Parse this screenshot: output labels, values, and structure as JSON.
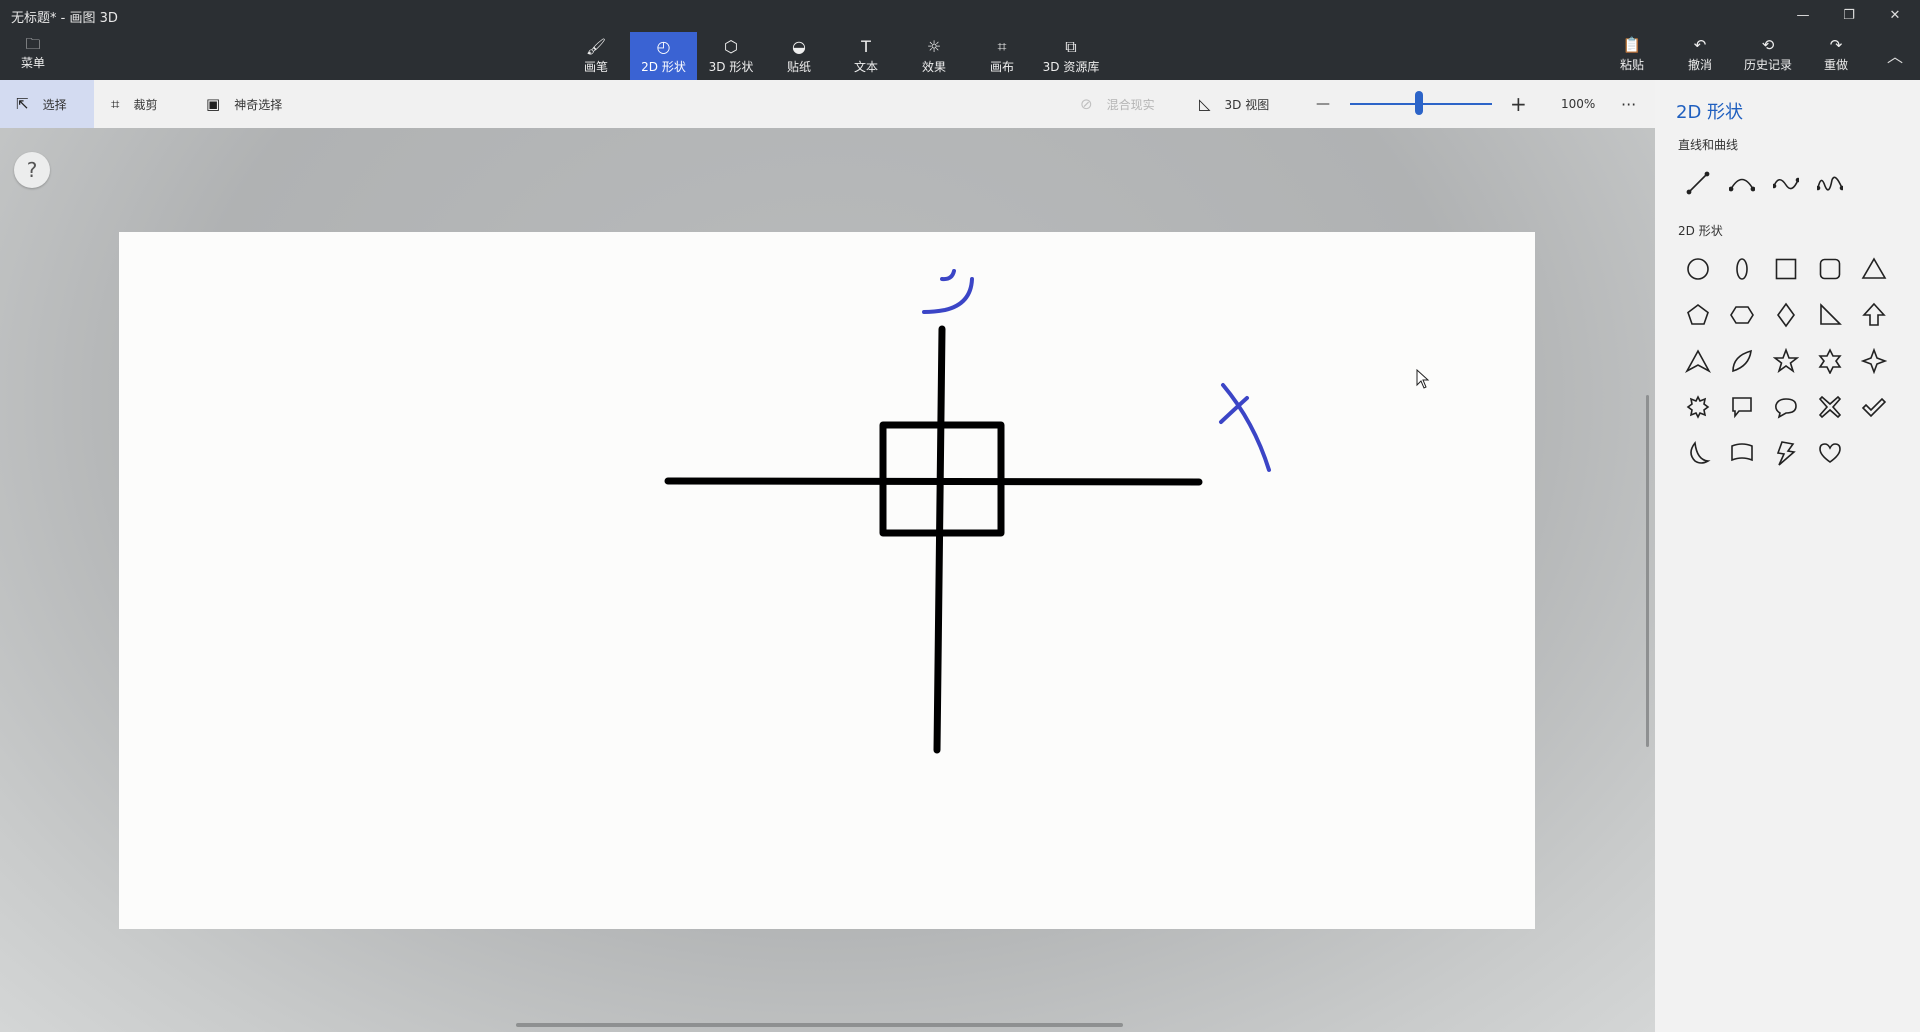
{
  "window": {
    "title": "无标题* - 画图 3D",
    "minimize": "—",
    "restore": "❐",
    "close": "✕"
  },
  "menu": {
    "label": "菜单",
    "icon": "folder-icon"
  },
  "tabs": [
    {
      "label": "画笔",
      "icon": "brush-icon"
    },
    {
      "label": "2D 形状",
      "icon": "2d-shapes-icon",
      "active": true
    },
    {
      "label": "3D 形状",
      "icon": "3d-shapes-icon"
    },
    {
      "label": "贴纸",
      "icon": "sticker-icon"
    },
    {
      "label": "文本",
      "icon": "text-icon"
    },
    {
      "label": "效果",
      "icon": "effects-icon"
    },
    {
      "label": "画布",
      "icon": "canvas-icon"
    },
    {
      "label": "3D 资源库",
      "icon": "3d-library-icon"
    }
  ],
  "right_actions": {
    "paste": "粘贴",
    "undo": "撤消",
    "history": "历史记录",
    "redo": "重做"
  },
  "toolbar": {
    "select": "选择",
    "crop": "裁剪",
    "magic_select": "神奇选择",
    "mixed_reality": "混合现实",
    "view_3d": "3D 视图",
    "zoom_out": "—",
    "zoom_in": "+",
    "zoom_percent": "100%",
    "more": "···",
    "zoom_level": 0.55
  },
  "help": {
    "label": "?"
  },
  "panel": {
    "title": "2D 形状",
    "lines_heading": "直线和曲线",
    "shapes_heading": "2D 形状",
    "lines": [
      "line-icon",
      "curve-icon",
      "three-point-curve-icon",
      "four-point-curve-icon"
    ],
    "shapes": [
      "circle-icon",
      "ellipse-icon",
      "square-icon",
      "rounded-square-icon",
      "triangle-icon",
      "pentagon-icon",
      "hexagon-icon",
      "diamond-icon",
      "right-triangle-icon",
      "arrow-up-icon",
      "arrow-head-icon",
      "leaf-icon",
      "star-five-icon",
      "star-six-icon",
      "star-four-icon",
      "burst-icon",
      "square-callout-icon",
      "round-callout-icon",
      "x-mark-icon",
      "check-mark-icon",
      "moon-icon",
      "banner-icon",
      "lightning-icon",
      "heart-icon"
    ]
  },
  "colors": {
    "accent": "#3a63d3",
    "ink_black": "#000000",
    "ink_blue": "#3b45c6"
  }
}
